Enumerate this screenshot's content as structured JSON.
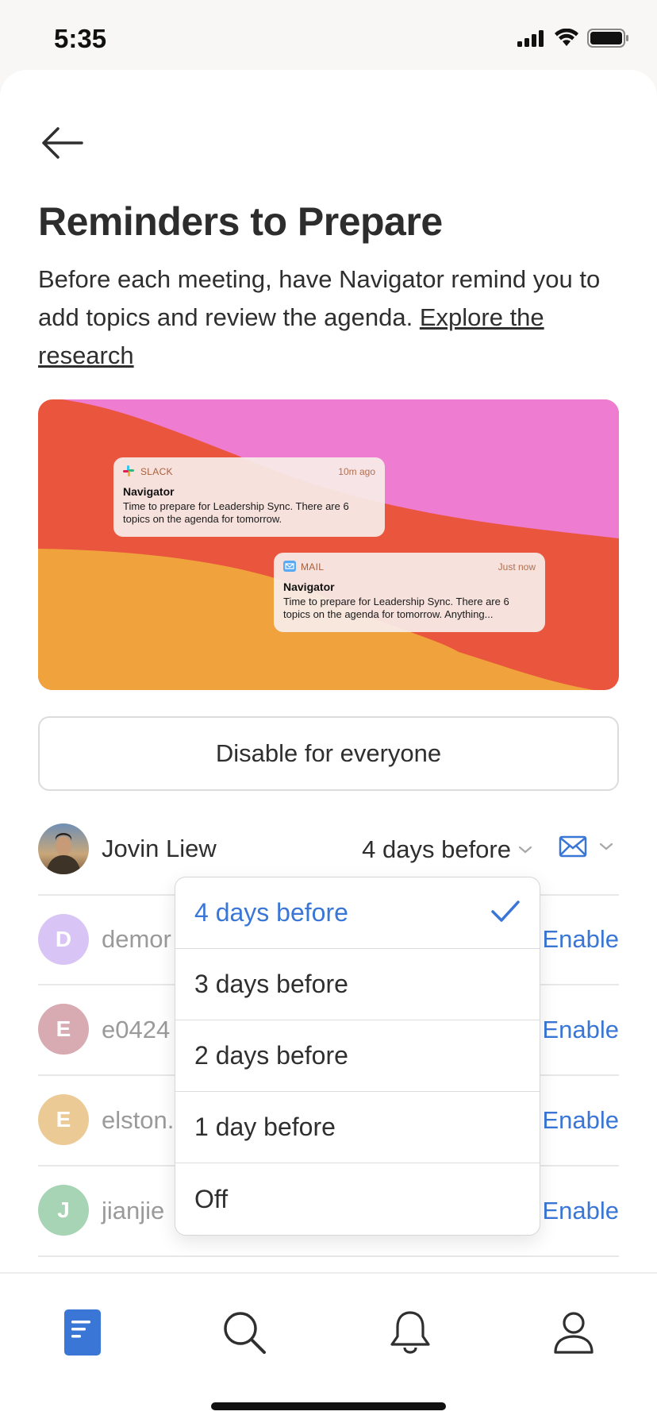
{
  "status_bar": {
    "time": "5:35"
  },
  "page": {
    "title": "Reminders to Prepare",
    "description": "Before each meeting, have Navigator remind you to add topics and review the agenda. ",
    "research_link": "Explore the research"
  },
  "hero": {
    "colors": {
      "pink": "#ee7cd1",
      "red": "#e9553d",
      "orange": "#f0a23c"
    },
    "notifications": [
      {
        "app": "SLACK",
        "time": "10m ago",
        "title": "Navigator",
        "body": "Time to prepare for Leadership Sync. There are 6 topics on the agenda for tomorrow."
      },
      {
        "app": "MAIL",
        "time": "Just now",
        "title": "Navigator",
        "body": "Time to prepare for Leadership Sync. There are 6 topics on the agenda for tomorrow. Anything..."
      }
    ]
  },
  "disable_button": {
    "label": "Disable for everyone"
  },
  "people": [
    {
      "name": "Jovin Liew",
      "setting": "4 days before",
      "channel": "mail-icon"
    },
    {
      "initial": "D",
      "name": "demor",
      "action": "Enable",
      "color": "#d9c5f5"
    },
    {
      "initial": "E",
      "name": "e0424",
      "action": "Enable",
      "color": "#d8aab2"
    },
    {
      "initial": "E",
      "name": "elston.",
      "action": "Enable",
      "color": "#ecca95"
    },
    {
      "initial": "J",
      "name": "jianjie",
      "action": "Enable",
      "color": "#a7d4b4"
    }
  ],
  "dropdown": {
    "options": [
      "4 days before",
      "3 days before",
      "2 days before",
      "1 day before",
      "Off"
    ],
    "selected": "4 days before"
  },
  "tabbar": {
    "items": [
      "docs-icon",
      "search-icon",
      "bell-icon",
      "profile-icon"
    ],
    "active": "docs-icon",
    "accent": "#3a76d6"
  }
}
